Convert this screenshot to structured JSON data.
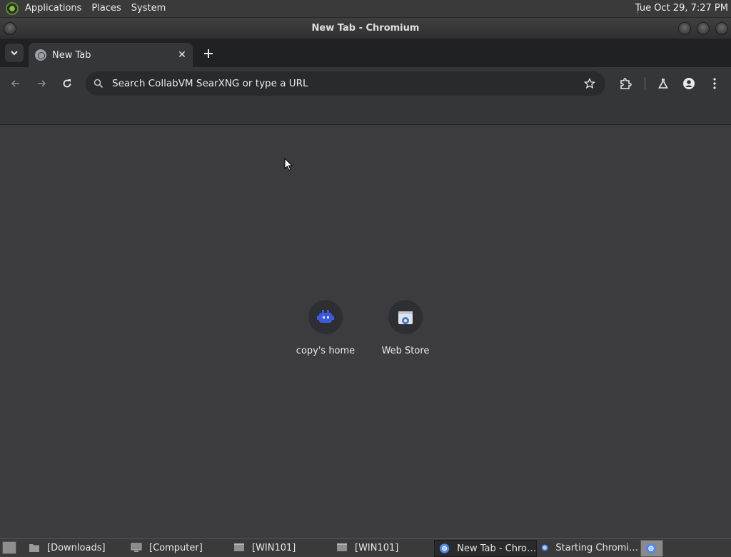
{
  "top_panel": {
    "menus": [
      "Applications",
      "Places",
      "System"
    ],
    "clock": "Tue Oct 29,  7:27 PM"
  },
  "window": {
    "title": "New Tab - Chromium"
  },
  "tabs": [
    {
      "label": "New Tab",
      "active": true
    }
  ],
  "omnibox": {
    "placeholder": "Search CollabVM SearXNG or type a URL"
  },
  "shortcuts": [
    {
      "label": "copy's home",
      "icon": "robot-icon"
    },
    {
      "label": "Web Store",
      "icon": "web-store-icon"
    }
  ],
  "taskbar": {
    "items": [
      {
        "label": "[Downloads]",
        "icon": "folder-icon",
        "active": false
      },
      {
        "label": "[Computer]",
        "icon": "computer-icon",
        "active": false
      },
      {
        "label": "[WIN101]",
        "icon": "window-icon",
        "active": false
      },
      {
        "label": "[WIN101]",
        "icon": "window-icon",
        "active": false
      },
      {
        "label": "New Tab - Chro…",
        "icon": "chromium-icon",
        "active": true
      },
      {
        "label": "Starting Chromi…",
        "icon": "chromium-icon",
        "active": false
      }
    ]
  },
  "colors": {
    "tabstrip": "#202124",
    "toolbar": "#35363a",
    "content": "#3c3c40",
    "omnibox": "#282a2d"
  }
}
